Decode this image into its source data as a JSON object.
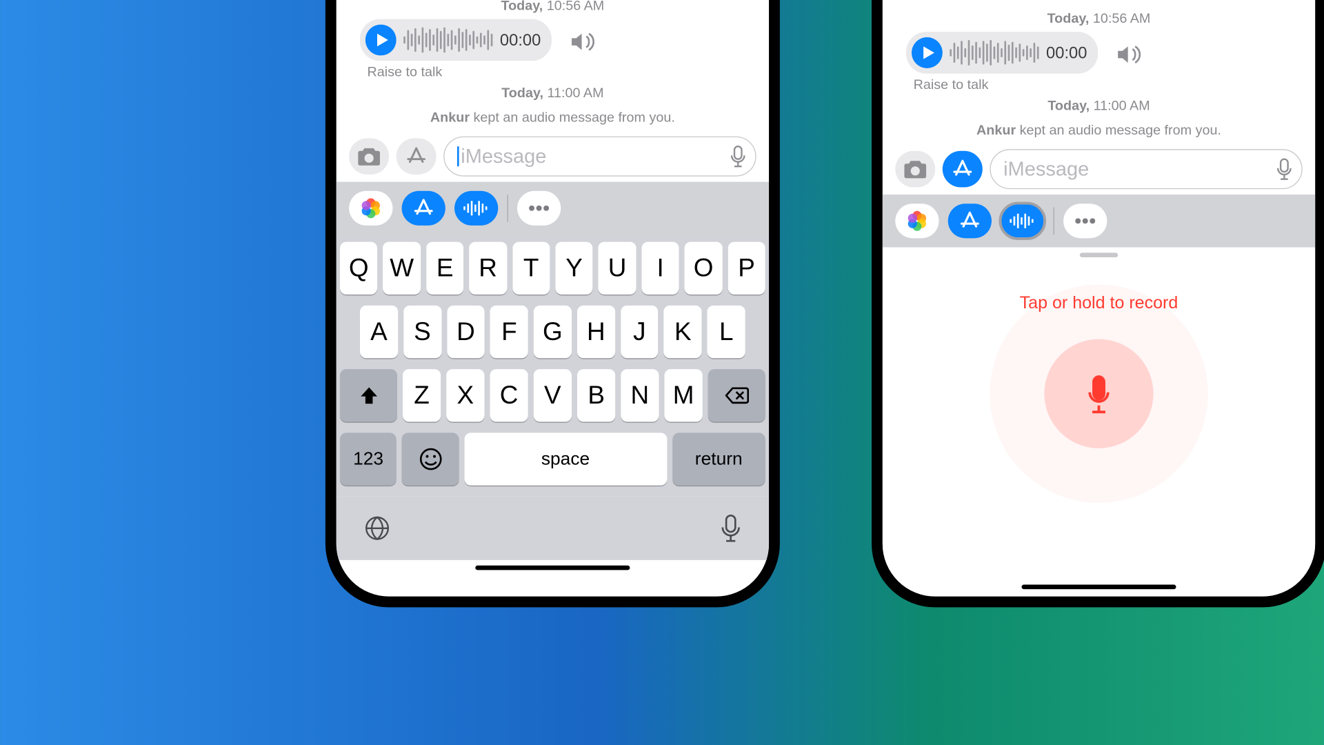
{
  "msg": {
    "ts1_bold": "Today,",
    "ts1_time": "10:56 AM",
    "audio_time": "00:00",
    "raise": "Raise to talk",
    "ts2_bold": "Today,",
    "ts2_time": "11:00 AM",
    "kept_name": "Ankur",
    "kept_rest": " kept an audio message from you."
  },
  "input": {
    "placeholder": "iMessage"
  },
  "record": {
    "hint": "Tap or hold to record"
  },
  "kb": {
    "r1": [
      "Q",
      "W",
      "E",
      "R",
      "T",
      "Y",
      "U",
      "I",
      "O",
      "P"
    ],
    "r2": [
      "A",
      "S",
      "D",
      "F",
      "G",
      "H",
      "J",
      "K",
      "L"
    ],
    "r3": [
      "Z",
      "X",
      "C",
      "V",
      "B",
      "N",
      "M"
    ],
    "num": "123",
    "space": "space",
    "ret": "return"
  }
}
